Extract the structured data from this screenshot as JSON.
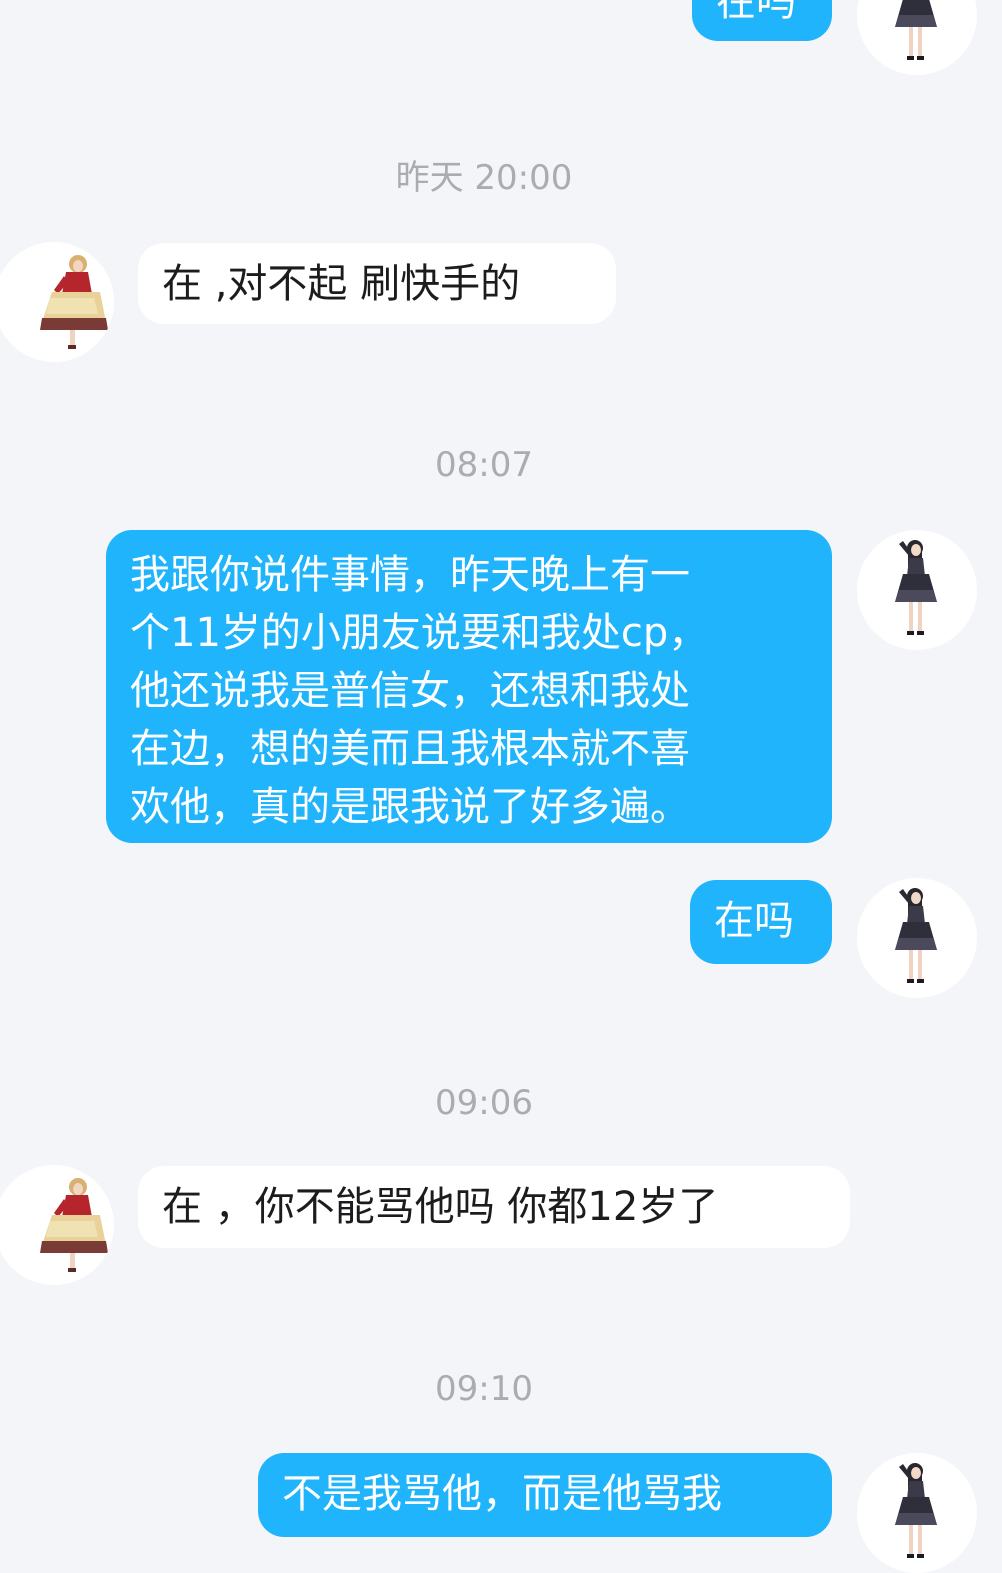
{
  "messages": [
    {
      "type": "outgoing",
      "text": "在吗"
    },
    {
      "type": "timestamp",
      "text": "昨天 20:00"
    },
    {
      "type": "incoming",
      "text": "在 ,对不起 刷快手的"
    },
    {
      "type": "timestamp",
      "text": "08:07"
    },
    {
      "type": "outgoing",
      "lines": [
        "我跟你说件事情，昨天晚上有一",
        "个11岁的小朋友说要和我处cp，",
        "他还说我是普信女，还想和我处",
        "在边，想的美而且我根本就不喜",
        "欢他，真的是跟我说了好多遍。"
      ]
    },
    {
      "type": "outgoing",
      "text": "在吗"
    },
    {
      "type": "timestamp",
      "text": "09:06"
    },
    {
      "type": "incoming",
      "text": "在 ，你不能骂他吗 你都12岁了"
    },
    {
      "type": "timestamp",
      "text": "09:10"
    },
    {
      "type": "outgoing",
      "text": "不是我骂他，而是他骂我"
    }
  ],
  "colors": {
    "background": "#f4f5f8",
    "outgoing_bubble": "#1fb4fb",
    "incoming_bubble": "#ffffff",
    "timestamp_text": "#a9acb1"
  },
  "icons": {
    "self_avatar": "girl-black-dress-avatar-icon",
    "contact_avatar": "girl-red-dress-avatar-icon"
  }
}
